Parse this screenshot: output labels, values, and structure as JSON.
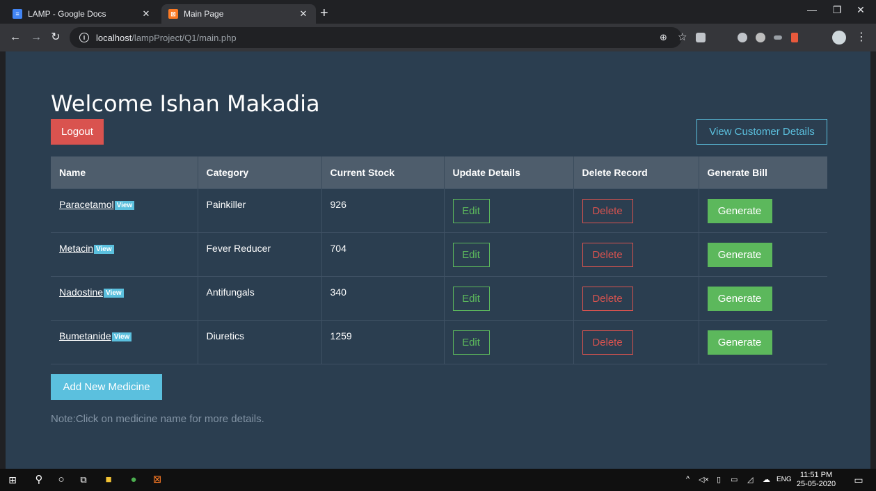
{
  "browser": {
    "tabs": [
      {
        "title": "LAMP - Google Docs",
        "active": false
      },
      {
        "title": "Main Page",
        "active": true
      }
    ],
    "url": {
      "host": "localhost",
      "path": "/lampProject/Q1/main.php"
    }
  },
  "page": {
    "heading": "Welcome Ishan Makadia",
    "logout_label": "Logout",
    "view_customers_label": "View Customer Details",
    "table": {
      "headers": [
        "Name",
        "Category",
        "Current Stock",
        "Update Details",
        "Delete Record",
        "Generate Bill"
      ],
      "rows": [
        {
          "name": "Paracetamol",
          "category": "Painkiller",
          "stock": "926"
        },
        {
          "name": "Metacin",
          "category": "Fever Reducer",
          "stock": "704"
        },
        {
          "name": "Nadostine",
          "category": "Antifungals",
          "stock": "340"
        },
        {
          "name": "Bumetanide",
          "category": "Diuretics",
          "stock": "1259"
        }
      ],
      "view_label": "View",
      "edit_label": "Edit",
      "delete_label": "Delete",
      "generate_label": "Generate"
    },
    "add_label": "Add New Medicine",
    "note": "Note:Click on medicine name for more details."
  },
  "taskbar": {
    "language": "ENG",
    "time": "11:51 PM",
    "date": "25-05-2020"
  },
  "colors": {
    "page_bg": "#2b3e50",
    "table_header_bg": "#4e5d6c",
    "danger": "#d9534f",
    "success": "#5cb85c",
    "info": "#5bc0de"
  }
}
